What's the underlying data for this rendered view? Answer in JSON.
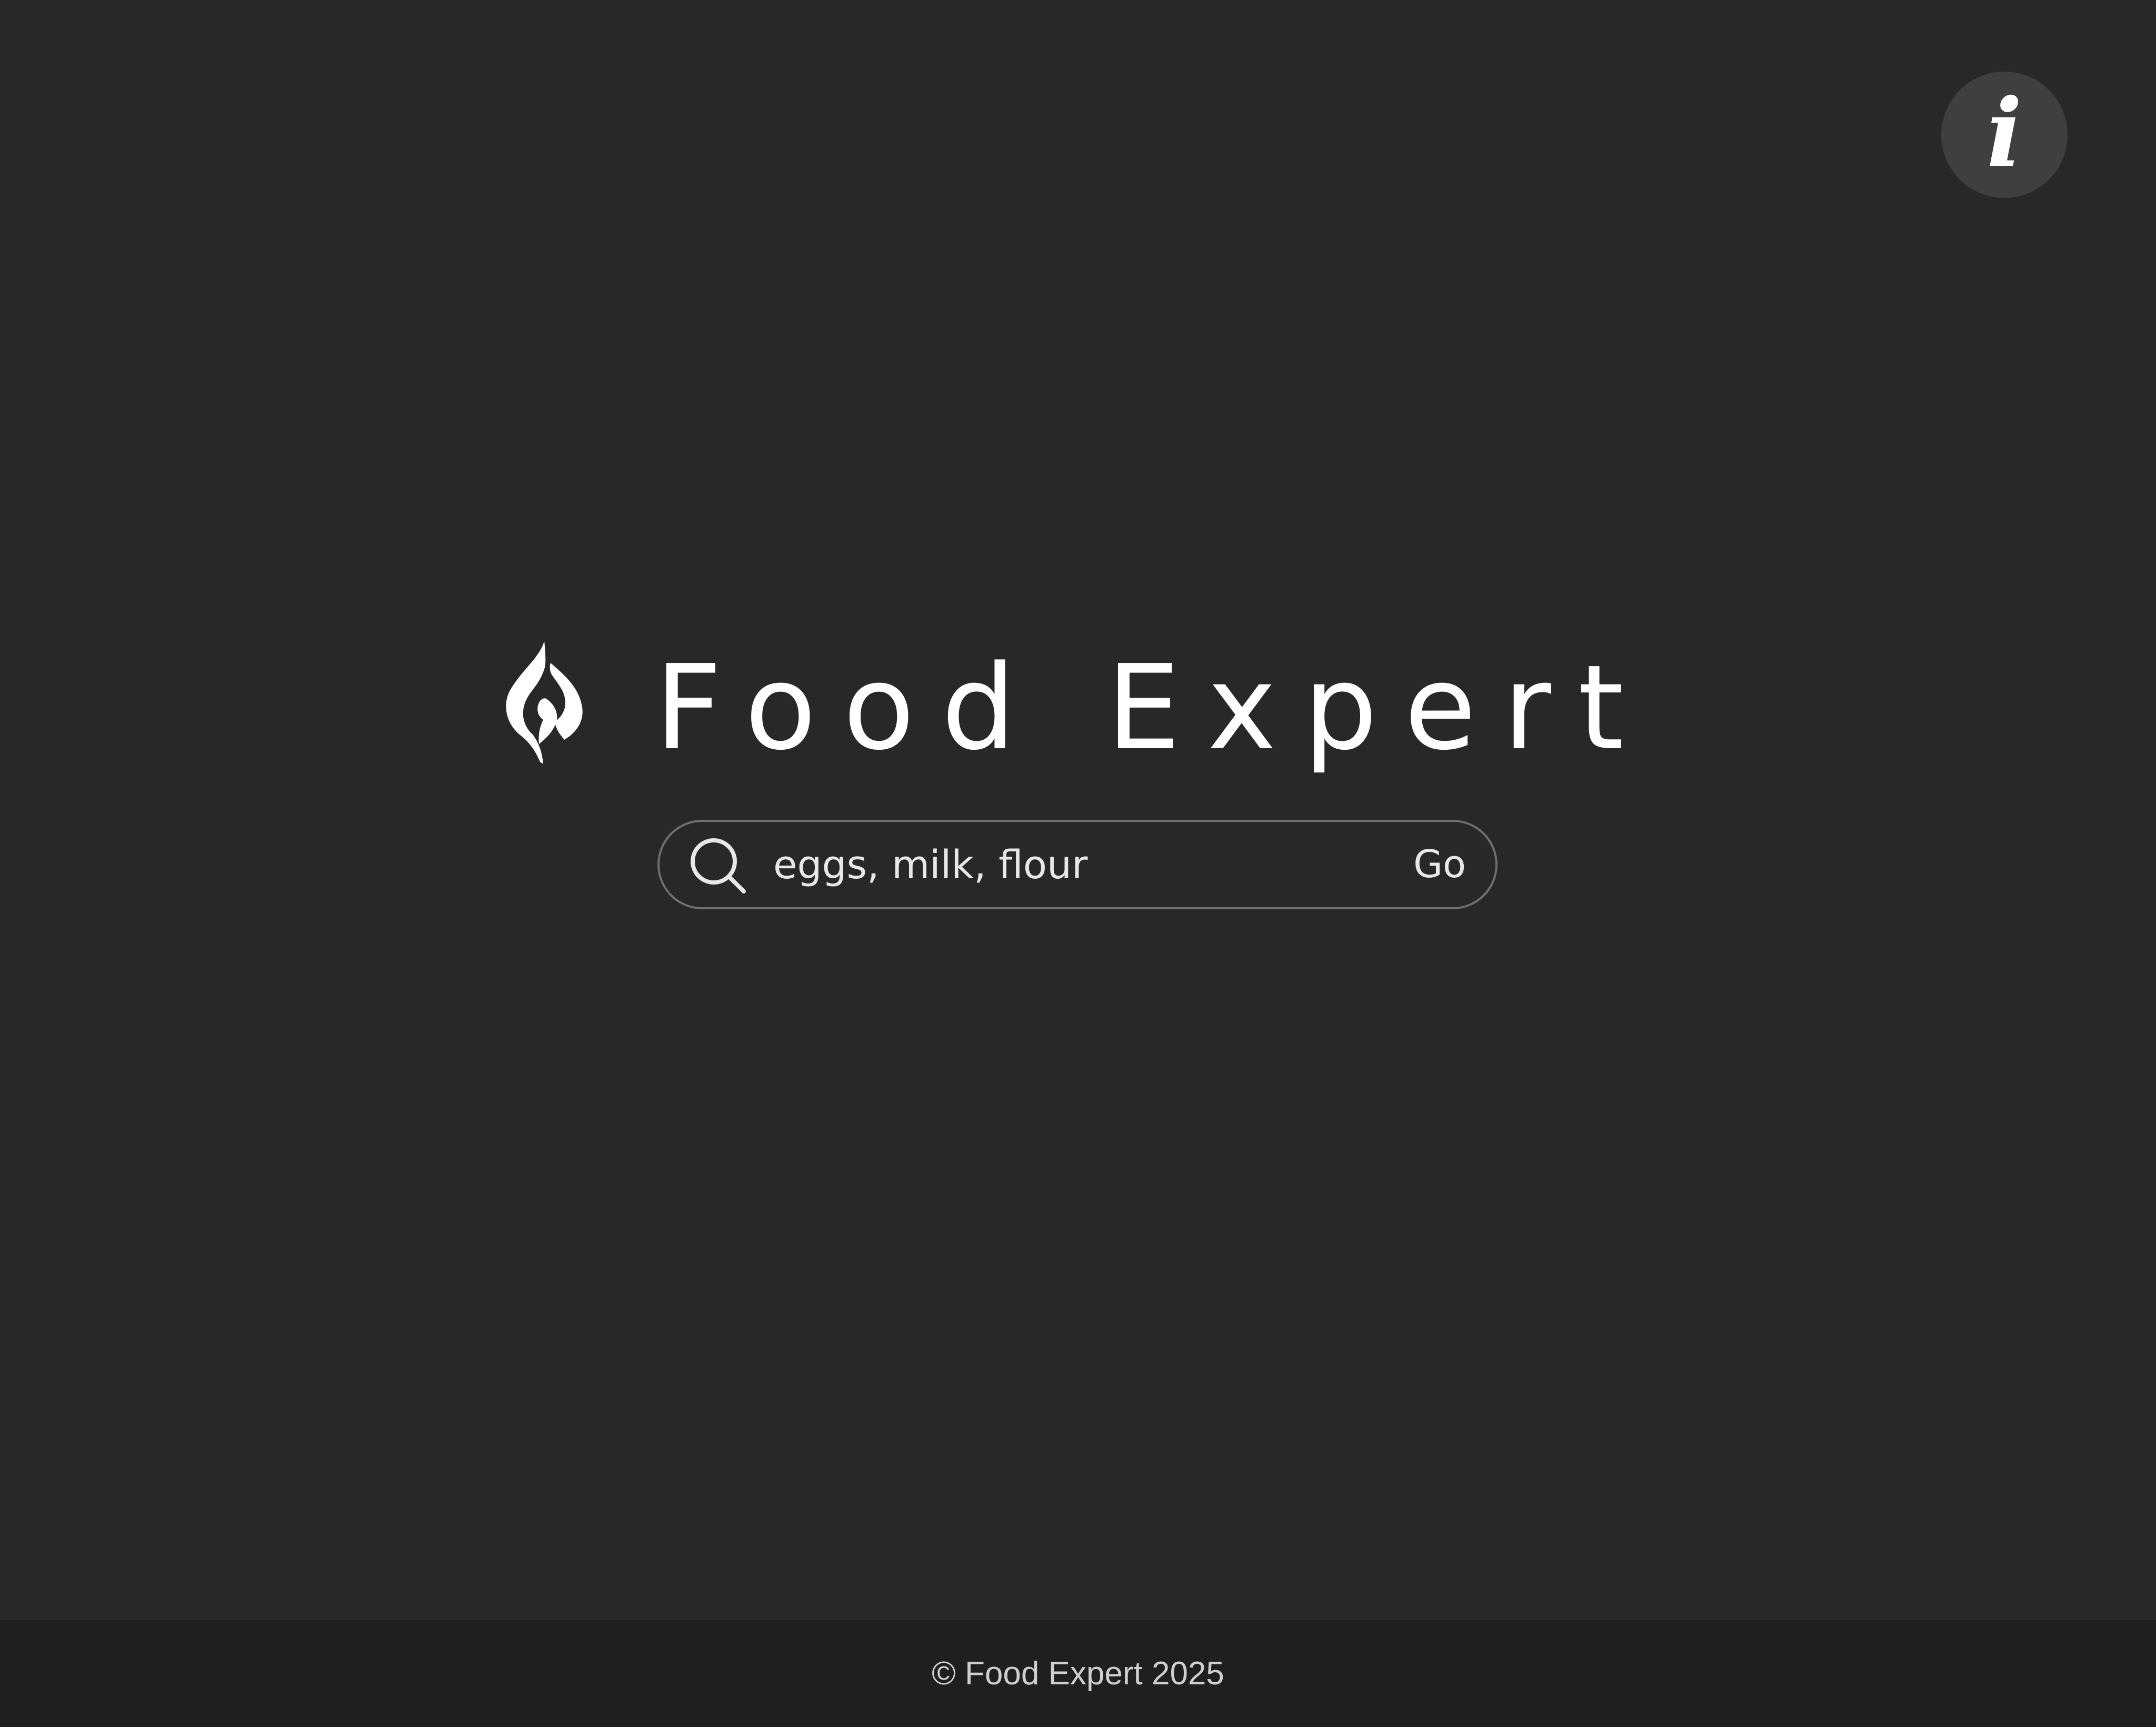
{
  "header": {
    "info_button": {
      "icon": "info-icon",
      "glyph": "i"
    }
  },
  "brand": {
    "logo_icon": "flame-leaf-icon",
    "title": "Food Expert"
  },
  "search": {
    "icon": "search-icon",
    "value": "eggs, milk, flour",
    "go_label": "Go"
  },
  "footer": {
    "text": "© Food Expert 2025"
  },
  "colors": {
    "background": "#282828",
    "footer_background": "#1f1f1f",
    "info_button_background": "#3f3f3f",
    "search_border": "#6f6f6f",
    "text_primary": "#ffffff"
  }
}
